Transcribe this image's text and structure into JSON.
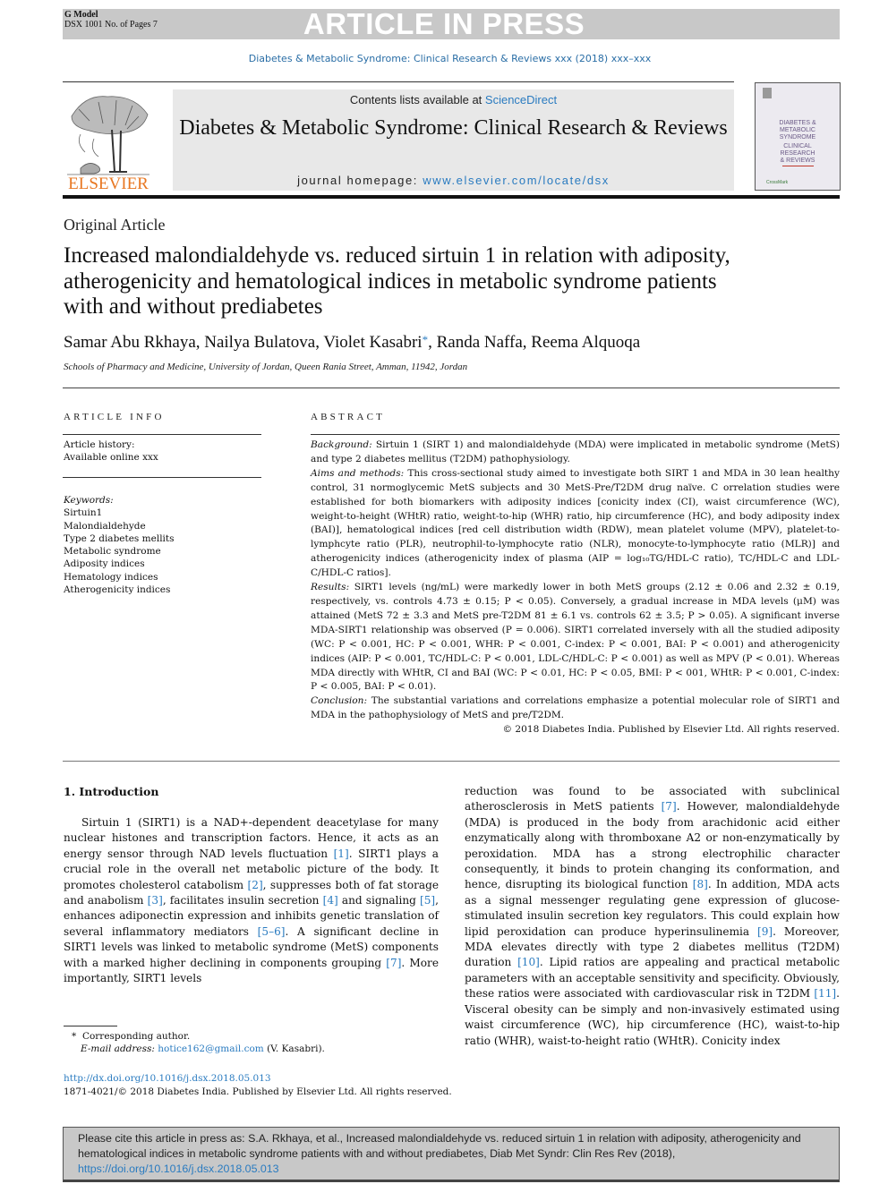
{
  "banner": {
    "gmodel": "G Model",
    "doc_info": "DSX 1001 No. of Pages 7",
    "status": "ARTICLE IN PRESS"
  },
  "journal_ref": "Diabetes & Metabolic Syndrome: Clinical Research & Reviews xxx (2018) xxx–xxx",
  "masthead": {
    "publisher_logo_text": "ELSEVIER",
    "contents_prefix": "Contents lists available at ",
    "contents_link": "ScienceDirect",
    "journal_title": "Diabetes & Metabolic Syndrome: Clinical Research & Reviews",
    "homepage_prefix": "journal homepage: ",
    "homepage_link": "www.elsevier.com/locate/dsx",
    "cover_lines": [
      "DIABETES &",
      "METABOLIC",
      "SYNDROME",
      "CLINICAL",
      "RESEARCH",
      "& REVIEWS"
    ],
    "cover_badge": "CrossMark"
  },
  "article": {
    "type": "Original Article",
    "title": "Increased malondialdehyde vs. reduced sirtuin 1 in relation with adiposity, atherogenicity and hematological indices in metabolic syndrome patients with and without prediabetes",
    "authors_before": "Samar Abu Rkhaya, Nailya Bulatova, Violet Kasabri",
    "author_marker": "*",
    "authors_after": ", Randa Naffa, Reema Alquoqa",
    "affiliation": "Schools of Pharmacy and Medicine, University of Jordan, Queen Rania Street, Amman, 11942, Jordan"
  },
  "article_info": {
    "heading": "ARTICLE INFO",
    "history_label": "Article history:",
    "history_value": "Available online xxx",
    "keywords_label": "Keywords:",
    "keywords": [
      "Sirtuin1",
      "Malondialdehyde",
      "Type 2 diabetes mellits",
      "Metabolic syndrome",
      "Adiposity indices",
      "Hematology indices",
      "Atherogenicity indices"
    ]
  },
  "abstract": {
    "heading": "ABSTRACT",
    "sections": [
      {
        "label": "Background:",
        "text": " Sirtuin 1 (SIRT 1) and malondialdehyde (MDA) were implicated in metabolic syndrome (MetS) and type 2 diabetes mellitus (T2DM) pathophysiology."
      },
      {
        "label": "Aims and methods:",
        "text": " This cross-sectional study aimed to investigate both SIRT 1 and MDA in 30 lean healthy control, 31 normoglycemic MetS subjects and 30 MetS-Pre/T2DM drug naïve. C orrelation studies were established for both biomarkers with adiposity indices [conicity index (CI), waist circumference (WC), weight-to-height (WHtR) ratio, weight-to-hip (WHR) ratio, hip circumference (HC), and body adiposity index (BAI)], hematological indices [red cell distribution width (RDW), mean platelet volume (MPV), platelet-to-lymphcyte ratio (PLR), neutrophil-to-lymphocyte ratio (NLR), monocyte-to-lymphocyte ratio (MLR)] and atherogenicity indices (atherogenicity index of plasma (AIP = log₁₀TG/HDL-C ratio), TC/HDL-C and LDL-C/HDL-C ratios]."
      },
      {
        "label": "Results:",
        "text": " SIRT1 levels (ng/mL) were markedly lower in both MetS groups (2.12 ± 0.06 and 2.32 ± 0.19, respectively, vs. controls 4.73 ± 0.15; P < 0.05). Conversely, a gradual increase in MDA levels (μM) was attained (MetS 72 ± 3.3 and MetS pre-T2DM 81 ± 6.1 vs. controls 62 ± 3.5; P > 0.05). A significant inverse MDA-SIRT1 relationship was observed (P = 0.006). SIRT1 correlated inversely with all the studied adiposity (WC: P < 0.001, HC: P < 0.001, WHR: P < 0.001, C-index: P < 0.001, BAI: P < 0.001) and atherogenicity indices (AIP: P < 0.001, TC/HDL-C: P < 0.001, LDL-C/HDL-C: P < 0.001) as well as MPV (P < 0.01). Whereas MDA directly with WHtR, CI and BAI (WC: P < 0.01, HC: P < 0.05, BMI: P < 001, WHtR: P < 0.001, C-index: P < 0.005, BAI: P < 0.01)."
      },
      {
        "label": "Conclusion:",
        "text": " The substantial variations and correlations emphasize a potential molecular role of SIRT1 and MDA in the pathophysiology of MetS and pre/T2DM."
      }
    ],
    "copyright": "© 2018 Diabetes India. Published by Elsevier Ltd. All rights reserved."
  },
  "introduction": {
    "heading": "1. Introduction",
    "left_column": [
      {
        "t": "Sirtuin 1 (SIRT1) is a NAD+-dependent deacetylase for many nuclear histones and transcription factors. Hence, it acts as an energy sensor through NAD levels fluctuation "
      },
      {
        "ref": "[1]"
      },
      {
        "t": ". SIRT1 plays a crucial role in the overall net metabolic picture of the body. It promotes cholesterol catabolism "
      },
      {
        "ref": "[2]"
      },
      {
        "t": ", suppresses both of fat storage and anabolism "
      },
      {
        "ref": "[3]"
      },
      {
        "t": ", facilitates insulin secretion "
      },
      {
        "ref": "[4]"
      },
      {
        "t": " and signaling "
      },
      {
        "ref": "[5]"
      },
      {
        "t": ", enhances adiponectin expression and inhibits genetic translation of several inflammatory mediators "
      },
      {
        "ref": "[5–6]"
      },
      {
        "t": ". A significant decline in SIRT1 levels was linked to metabolic syndrome (MetS) components with a marked higher declining in components grouping "
      },
      {
        "ref": "[7]"
      },
      {
        "t": ". More importantly, SIRT1 levels"
      }
    ],
    "right_column": [
      {
        "t": "reduction was found to be associated with subclinical atherosclerosis in MetS patients "
      },
      {
        "ref": "[7]"
      },
      {
        "t": ". However, malondialdehyde (MDA) is produced in the body from arachidonic acid either enzymatically along with thromboxane A2 or non-enzymatically by peroxidation. MDA has a strong electrophilic character consequently, it binds to protein changing its conformation, and hence, disrupting its biological function "
      },
      {
        "ref": "[8]"
      },
      {
        "t": ". In addition, MDA acts as a signal messenger regulating gene expression of glucose-stimulated insulin secretion key regulators. This could explain how lipid peroxidation can produce hyperinsulinemia "
      },
      {
        "ref": "[9]"
      },
      {
        "t": ". Moreover, MDA elevates directly with type 2 diabetes mellitus (T2DM) duration "
      },
      {
        "ref": "[10]"
      },
      {
        "t": ". Lipid ratios are appealing and practical metabolic parameters with an acceptable sensitivity and specificity. Obviously, these ratios were associated with cardiovascular risk in T2DM "
      },
      {
        "ref": "[11]"
      },
      {
        "t": ". Visceral obesity can be simply and non-invasively estimated using waist circumference (WC), hip circumference (HC), waist-to-hip ratio (WHR), waist-to-height ratio (WHtR). Conicity index"
      }
    ]
  },
  "footnote": {
    "marker": "*",
    "corresponding": "Corresponding author.",
    "email_label": "E-mail address:",
    "email": "hotice162@gmail.com",
    "email_owner": " (V. Kasabri)."
  },
  "doi": {
    "link": "http://dx.doi.org/10.1016/j.dsx.2018.05.013",
    "issn_line": "1871-4021/© 2018 Diabetes India. Published by Elsevier Ltd. All rights reserved."
  },
  "cite_box": {
    "text": "Please cite this article in press as: S.A. Rkhaya, et al., Increased malondialdehyde vs. reduced sirtuin 1 in relation with adiposity, atherogenicity and hematological indices in metabolic syndrome patients with and without prediabetes, Diab Met Syndr: Clin Res Rev (2018), ",
    "link": "https://doi.org/10.1016/j.dsx.2018.05.013"
  },
  "colors": {
    "link": "#2a7bc0",
    "banner_gray": "#c8c8c8",
    "elsevier_orange": "#e87722"
  }
}
